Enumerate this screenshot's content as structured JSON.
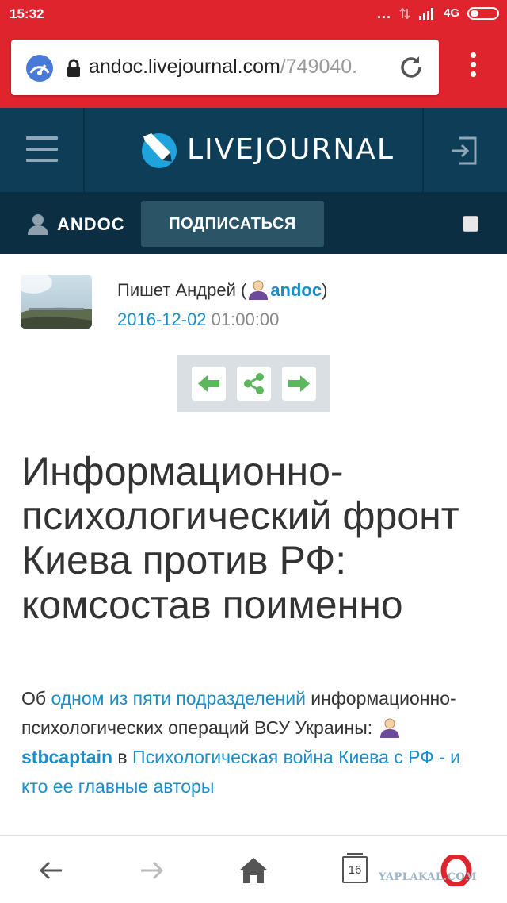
{
  "status_bar": {
    "time": "15:32",
    "dots": "...",
    "network": "4G"
  },
  "browser": {
    "url_host": "andoc.livejournal.com",
    "url_rest": "/749040."
  },
  "header": {
    "brand": "LIVEJOURNAL"
  },
  "userbar": {
    "username": "ANDOC",
    "subscribe": "ПОДПИСАТЬСЯ"
  },
  "post": {
    "author_prefix": "Пишет Андрей (",
    "author_user": "andoc",
    "author_suffix": ")",
    "date": "2016-12-02",
    "time": "01:00:00",
    "title": "Информационно-психологический фронт Киева против РФ: комсостав поименно",
    "body": {
      "p1": "Об ",
      "link1": "одном из пяти подразделений",
      "p2": " информационно-психологических операций ВСУ Украины: ",
      "user": "stbcaptain",
      "p3": " в ",
      "link2": "Психологическая война Киева с РФ - и кто ее главные авторы"
    }
  },
  "bottom_nav": {
    "tabs_count": "16"
  },
  "watermark": "YAPLAKAL.COM",
  "colors": {
    "browser_red": "#e0242e",
    "lj_dark": "#0e3d57",
    "link": "#1a8ec9",
    "green": "#5cb85c"
  }
}
